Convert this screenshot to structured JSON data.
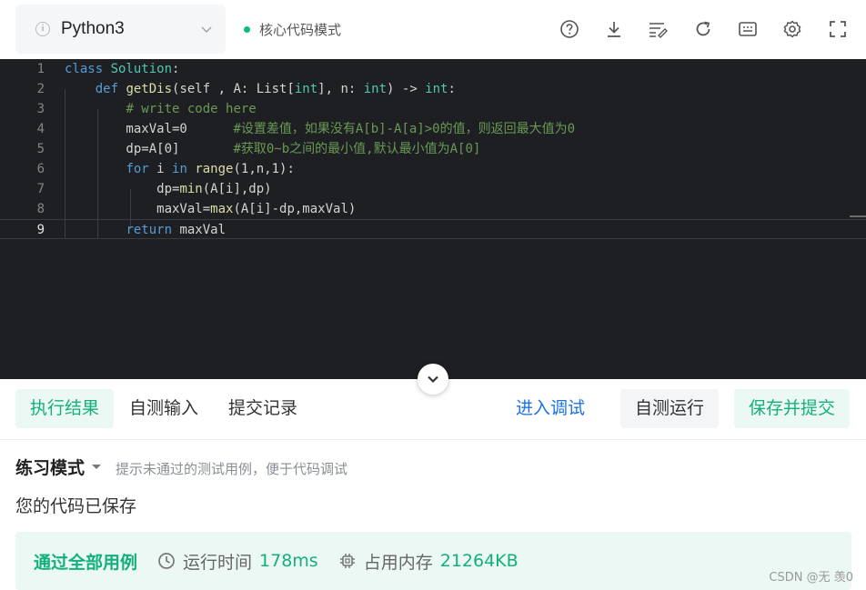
{
  "header": {
    "language": "Python3",
    "mode_label": "核心代码模式"
  },
  "toolbar_icons": [
    "help-circle-icon",
    "download-icon",
    "format-icon",
    "reset-icon",
    "keyboard-icon",
    "settings-icon",
    "fullscreen-icon"
  ],
  "editor": {
    "line_numbers": [
      "1",
      "2",
      "3",
      "4",
      "5",
      "6",
      "7",
      "8",
      "9"
    ],
    "lines": [
      [
        [
          "class ",
          "kw"
        ],
        [
          "Solution",
          "cls"
        ],
        [
          ":",
          ""
        ]
      ],
      [
        [
          "    ",
          ""
        ],
        [
          "def ",
          "kw"
        ],
        [
          "getDis",
          "fn"
        ],
        [
          "(self , A: List[",
          ""
        ],
        [
          "int",
          "cls"
        ],
        [
          "], n: ",
          ""
        ],
        [
          "int",
          "cls"
        ],
        [
          ") -> ",
          ""
        ],
        [
          "int",
          "cls"
        ],
        [
          ":",
          ""
        ]
      ],
      [
        [
          "        ",
          ""
        ],
        [
          "# write code here",
          "cmt"
        ]
      ],
      [
        [
          "        maxVal=0      ",
          ""
        ],
        [
          "#设置差值，如果没有A[b]-A[a]>0的值，则返回最大值为0",
          "cmt"
        ]
      ],
      [
        [
          "        dp=A[0]       ",
          ""
        ],
        [
          "#获取0~b之间的最小值,默认最小值为A[0]",
          "cmt"
        ]
      ],
      [
        [
          "        ",
          ""
        ],
        [
          "for ",
          "kw"
        ],
        [
          "i ",
          ""
        ],
        [
          "in ",
          "kw"
        ],
        [
          "range",
          "fn"
        ],
        [
          "(1,n,1):",
          ""
        ]
      ],
      [
        [
          "            dp=",
          ""
        ],
        [
          "min",
          "fn"
        ],
        [
          "(A[i],dp)",
          ""
        ]
      ],
      [
        [
          "            maxVal=",
          ""
        ],
        [
          "max",
          "fn"
        ],
        [
          "(A[i]-dp,maxVal)",
          ""
        ]
      ],
      [
        [
          "        ",
          ""
        ],
        [
          "return ",
          "kw"
        ],
        [
          "maxVal",
          ""
        ]
      ]
    ],
    "active_line": 9
  },
  "tabs": {
    "result": "执行结果",
    "custom_input": "自测输入",
    "history": "提交记录"
  },
  "actions": {
    "debug": "进入调试",
    "run": "自测运行",
    "submit": "保存并提交"
  },
  "results": {
    "practice_mode": "练习模式",
    "practice_hint": "提示未通过的测试用例，便于代码调试",
    "saved_message": "您的代码已保存",
    "pass_label": "通过全部用例",
    "runtime_label": "运行时间",
    "runtime_value": "178ms",
    "memory_label": "占用内存",
    "memory_value": "21264KB"
  },
  "watermark": "CSDN @无 羡0",
  "colors": {
    "accent_green": "#13b07e",
    "link_blue": "#1a73e8",
    "editor_bg": "#1e1f22"
  }
}
